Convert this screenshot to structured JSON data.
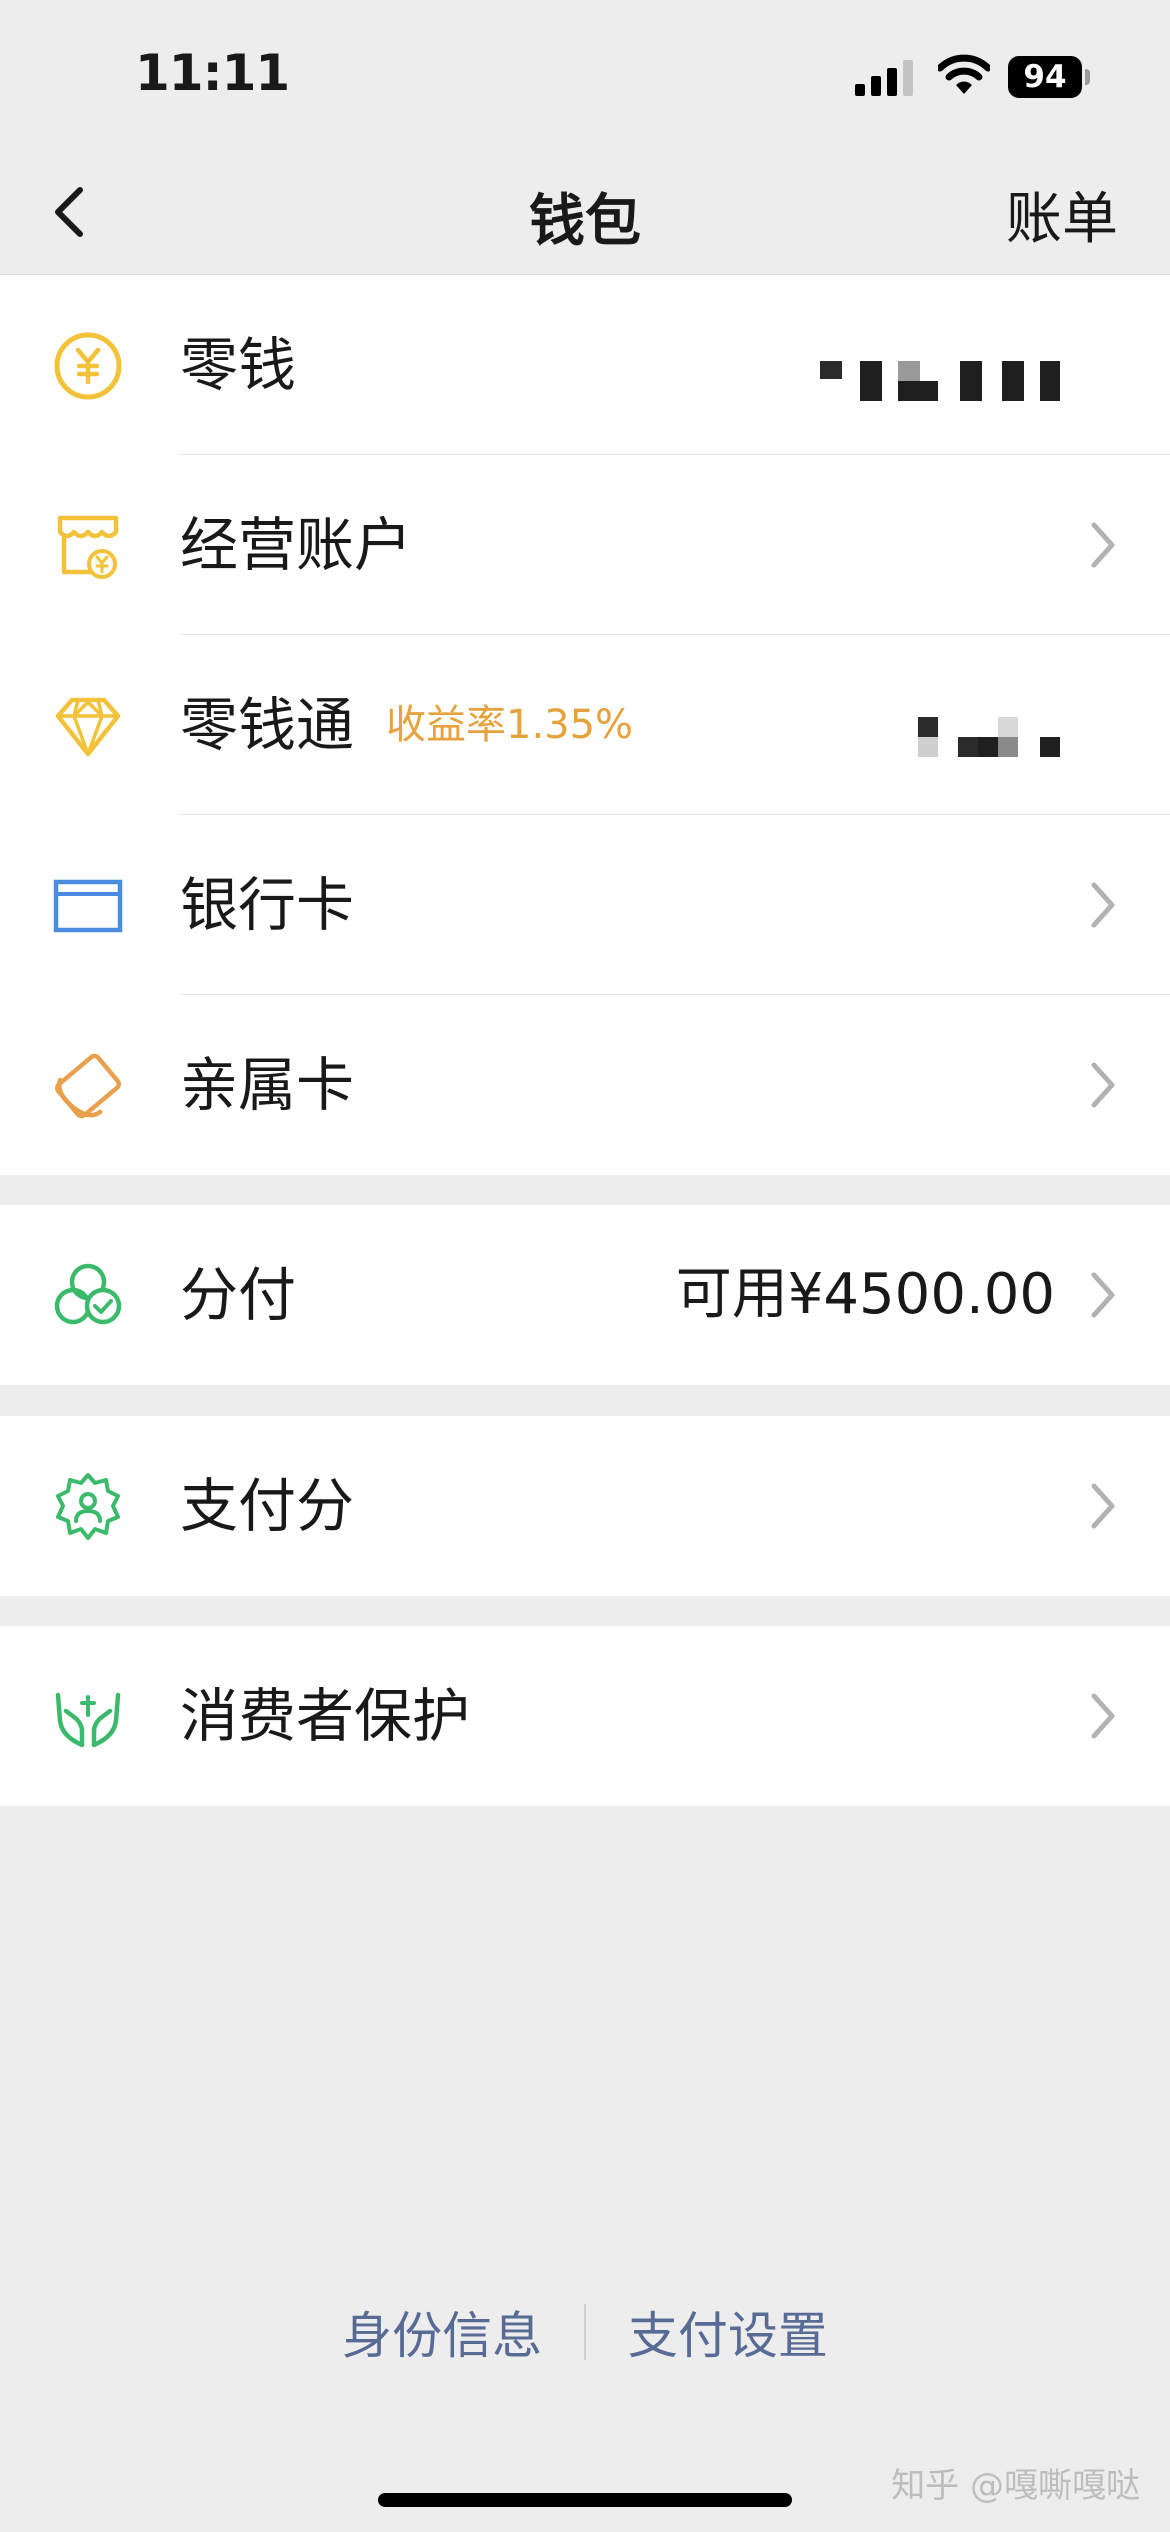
{
  "status_bar": {
    "time": "11:11",
    "battery": "94"
  },
  "nav": {
    "title": "钱包",
    "right_action": "账单"
  },
  "groups": [
    {
      "items": [
        {
          "label": "零钱",
          "icon": "yuan-coin-icon",
          "value": "masked",
          "chevron": false
        },
        {
          "label": "经营账户",
          "icon": "shop-icon",
          "chevron": true
        },
        {
          "label": "零钱通",
          "icon": "diamond-icon",
          "badge": "收益率1.35%",
          "value": "masked",
          "chevron": false
        },
        {
          "label": "银行卡",
          "icon": "bank-card-icon",
          "chevron": true
        },
        {
          "label": "亲属卡",
          "icon": "family-card-icon",
          "chevron": true
        }
      ]
    },
    {
      "items": [
        {
          "label": "分付",
          "icon": "fenfu-icon",
          "value": "可用¥4500.00",
          "chevron": true
        }
      ]
    },
    {
      "items": [
        {
          "label": "支付分",
          "icon": "payment-score-icon",
          "chevron": true
        }
      ]
    },
    {
      "items": [
        {
          "label": "消费者保护",
          "icon": "consumer-protection-icon",
          "chevron": true
        }
      ]
    }
  ],
  "footer": {
    "links": [
      "身份信息",
      "支付设置"
    ],
    "watermark": "知乎 @嘎嘶嘎哒"
  },
  "colors": {
    "accent_yellow": "#f2c23a",
    "accent_orange": "#e8a04c",
    "accent_blue": "#4a8de0",
    "accent_green": "#3cba6b",
    "link": "#576b95"
  }
}
